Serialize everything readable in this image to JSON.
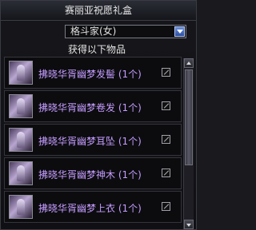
{
  "window": {
    "title": "赛丽亚祝愿礼盒"
  },
  "dropdown": {
    "selected": "格斗家(女)"
  },
  "list": {
    "header": "获得以下物品",
    "items": [
      {
        "name": "拂晓华胥幽梦发髻 (1个)",
        "checked": false
      },
      {
        "name": "拂晓华胥幽梦卷发 (1个)",
        "checked": false
      },
      {
        "name": "拂晓华胥幽梦耳坠 (1个)",
        "checked": false
      },
      {
        "name": "拂晓华胥幽梦神木 (1个)",
        "checked": false
      },
      {
        "name": "拂晓华胥幽梦上衣 (1个)",
        "checked": false
      }
    ]
  },
  "colors": {
    "item_text": "#c59cff",
    "accent": "#2b4fa0"
  }
}
